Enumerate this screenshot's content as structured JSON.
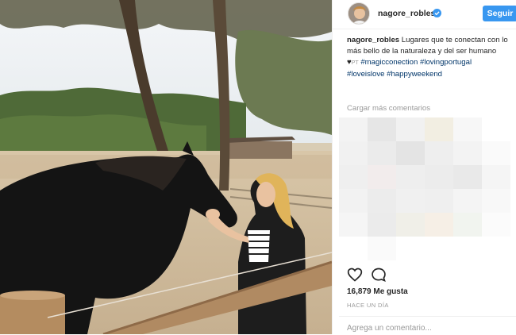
{
  "post": {
    "username": "nagore_robles",
    "verified": true,
    "follow_label": "Seguir",
    "caption": {
      "username": "nagore_robles",
      "text": " Lugares que te conectan con lo más bello de la naturaleza y del ser humano ♥",
      "tags": [
        "#magicconection",
        "#lovingportugal",
        "#loveislove",
        "#happyweekend"
      ]
    },
    "load_more_label": "Cargar más comentarios",
    "likes": "16,879 Me gusta",
    "timestamp": "HACE UN DÍA",
    "comment_placeholder": "Agrega un comentario..."
  },
  "colors": {
    "accent": "#3897f0",
    "hashtag": "#003569",
    "muted": "#999999",
    "text": "#262626"
  },
  "icons": [
    "verified-badge-icon",
    "heart-icon",
    "comment-icon"
  ]
}
